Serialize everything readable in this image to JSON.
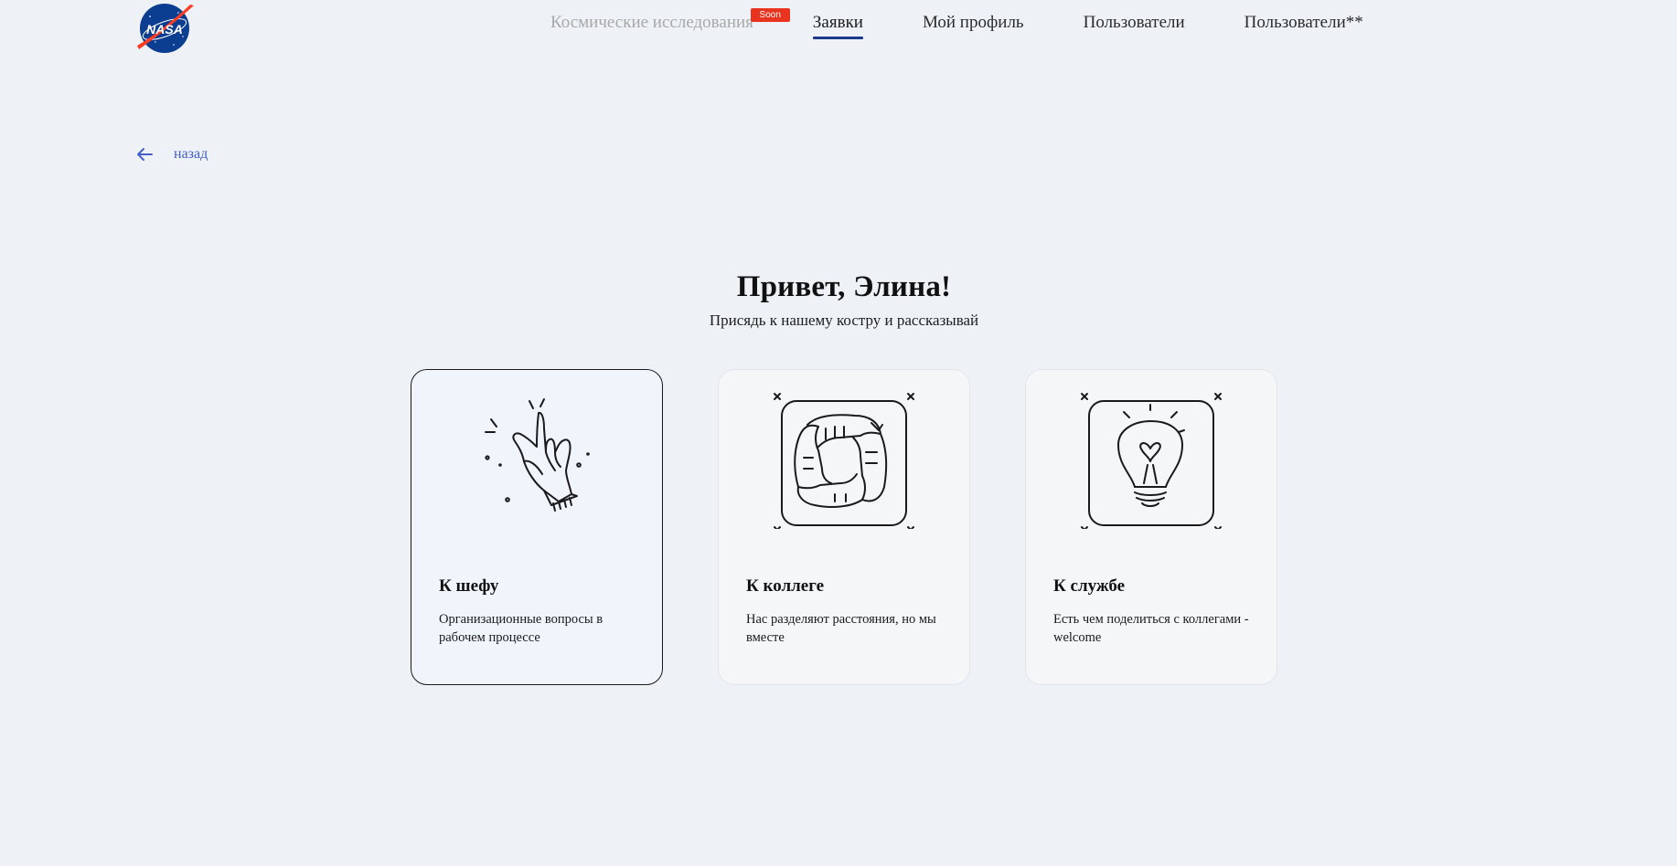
{
  "header": {
    "logo_text": "NASA",
    "nav": [
      {
        "label": "Космические исследования",
        "badge": "Soon",
        "state": "disabled"
      },
      {
        "label": "Заявки",
        "state": "active"
      },
      {
        "label": "Мой профиль",
        "state": "default"
      },
      {
        "label": "Пользователи",
        "state": "default"
      },
      {
        "label": "Пользователи**",
        "state": "default"
      }
    ]
  },
  "back": {
    "label": "назад",
    "icon": "arrow-left-icon"
  },
  "greeting": {
    "title": "Привет, Элина!",
    "subtitle": "Присядь к нашему костру и рассказывай"
  },
  "cards": [
    {
      "title": "К шефу",
      "description": "Организационные вопросы в рабочем процессе",
      "icon": "rock-hand-icon",
      "selected": true
    },
    {
      "title": "К коллеге",
      "description": "Нас разделяют расстояния, но мы вместе",
      "icon": "teamwork-hands-icon",
      "selected": false
    },
    {
      "title": "К службе",
      "description": "Есть чем поделиться с коллегами - welcome",
      "icon": "lightbulb-icon",
      "selected": false
    }
  ],
  "colors": {
    "background": "#eef2f6",
    "accent_underline": "#1c3a8a",
    "badge": "#e8331e",
    "link": "#4460c8",
    "selected_card_bg": "#f0f5fc"
  }
}
